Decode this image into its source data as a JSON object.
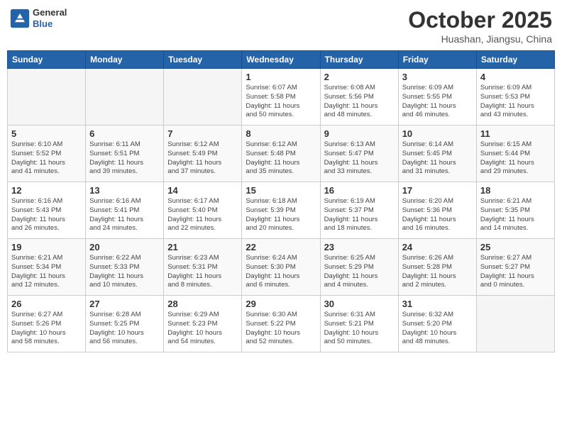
{
  "header": {
    "logo_general": "General",
    "logo_blue": "Blue",
    "title": "October 2025",
    "subtitle": "Huashan, Jiangsu, China"
  },
  "weekdays": [
    "Sunday",
    "Monday",
    "Tuesday",
    "Wednesday",
    "Thursday",
    "Friday",
    "Saturday"
  ],
  "weeks": [
    [
      {
        "day": "",
        "info": ""
      },
      {
        "day": "",
        "info": ""
      },
      {
        "day": "",
        "info": ""
      },
      {
        "day": "1",
        "info": "Sunrise: 6:07 AM\nSunset: 5:58 PM\nDaylight: 11 hours\nand 50 minutes."
      },
      {
        "day": "2",
        "info": "Sunrise: 6:08 AM\nSunset: 5:56 PM\nDaylight: 11 hours\nand 48 minutes."
      },
      {
        "day": "3",
        "info": "Sunrise: 6:09 AM\nSunset: 5:55 PM\nDaylight: 11 hours\nand 46 minutes."
      },
      {
        "day": "4",
        "info": "Sunrise: 6:09 AM\nSunset: 5:53 PM\nDaylight: 11 hours\nand 43 minutes."
      }
    ],
    [
      {
        "day": "5",
        "info": "Sunrise: 6:10 AM\nSunset: 5:52 PM\nDaylight: 11 hours\nand 41 minutes."
      },
      {
        "day": "6",
        "info": "Sunrise: 6:11 AM\nSunset: 5:51 PM\nDaylight: 11 hours\nand 39 minutes."
      },
      {
        "day": "7",
        "info": "Sunrise: 6:12 AM\nSunset: 5:49 PM\nDaylight: 11 hours\nand 37 minutes."
      },
      {
        "day": "8",
        "info": "Sunrise: 6:12 AM\nSunset: 5:48 PM\nDaylight: 11 hours\nand 35 minutes."
      },
      {
        "day": "9",
        "info": "Sunrise: 6:13 AM\nSunset: 5:47 PM\nDaylight: 11 hours\nand 33 minutes."
      },
      {
        "day": "10",
        "info": "Sunrise: 6:14 AM\nSunset: 5:45 PM\nDaylight: 11 hours\nand 31 minutes."
      },
      {
        "day": "11",
        "info": "Sunrise: 6:15 AM\nSunset: 5:44 PM\nDaylight: 11 hours\nand 29 minutes."
      }
    ],
    [
      {
        "day": "12",
        "info": "Sunrise: 6:16 AM\nSunset: 5:43 PM\nDaylight: 11 hours\nand 26 minutes."
      },
      {
        "day": "13",
        "info": "Sunrise: 6:16 AM\nSunset: 5:41 PM\nDaylight: 11 hours\nand 24 minutes."
      },
      {
        "day": "14",
        "info": "Sunrise: 6:17 AM\nSunset: 5:40 PM\nDaylight: 11 hours\nand 22 minutes."
      },
      {
        "day": "15",
        "info": "Sunrise: 6:18 AM\nSunset: 5:39 PM\nDaylight: 11 hours\nand 20 minutes."
      },
      {
        "day": "16",
        "info": "Sunrise: 6:19 AM\nSunset: 5:37 PM\nDaylight: 11 hours\nand 18 minutes."
      },
      {
        "day": "17",
        "info": "Sunrise: 6:20 AM\nSunset: 5:36 PM\nDaylight: 11 hours\nand 16 minutes."
      },
      {
        "day": "18",
        "info": "Sunrise: 6:21 AM\nSunset: 5:35 PM\nDaylight: 11 hours\nand 14 minutes."
      }
    ],
    [
      {
        "day": "19",
        "info": "Sunrise: 6:21 AM\nSunset: 5:34 PM\nDaylight: 11 hours\nand 12 minutes."
      },
      {
        "day": "20",
        "info": "Sunrise: 6:22 AM\nSunset: 5:33 PM\nDaylight: 11 hours\nand 10 minutes."
      },
      {
        "day": "21",
        "info": "Sunrise: 6:23 AM\nSunset: 5:31 PM\nDaylight: 11 hours\nand 8 minutes."
      },
      {
        "day": "22",
        "info": "Sunrise: 6:24 AM\nSunset: 5:30 PM\nDaylight: 11 hours\nand 6 minutes."
      },
      {
        "day": "23",
        "info": "Sunrise: 6:25 AM\nSunset: 5:29 PM\nDaylight: 11 hours\nand 4 minutes."
      },
      {
        "day": "24",
        "info": "Sunrise: 6:26 AM\nSunset: 5:28 PM\nDaylight: 11 hours\nand 2 minutes."
      },
      {
        "day": "25",
        "info": "Sunrise: 6:27 AM\nSunset: 5:27 PM\nDaylight: 11 hours\nand 0 minutes."
      }
    ],
    [
      {
        "day": "26",
        "info": "Sunrise: 6:27 AM\nSunset: 5:26 PM\nDaylight: 10 hours\nand 58 minutes."
      },
      {
        "day": "27",
        "info": "Sunrise: 6:28 AM\nSunset: 5:25 PM\nDaylight: 10 hours\nand 56 minutes."
      },
      {
        "day": "28",
        "info": "Sunrise: 6:29 AM\nSunset: 5:23 PM\nDaylight: 10 hours\nand 54 minutes."
      },
      {
        "day": "29",
        "info": "Sunrise: 6:30 AM\nSunset: 5:22 PM\nDaylight: 10 hours\nand 52 minutes."
      },
      {
        "day": "30",
        "info": "Sunrise: 6:31 AM\nSunset: 5:21 PM\nDaylight: 10 hours\nand 50 minutes."
      },
      {
        "day": "31",
        "info": "Sunrise: 6:32 AM\nSunset: 5:20 PM\nDaylight: 10 hours\nand 48 minutes."
      },
      {
        "day": "",
        "info": ""
      }
    ]
  ]
}
